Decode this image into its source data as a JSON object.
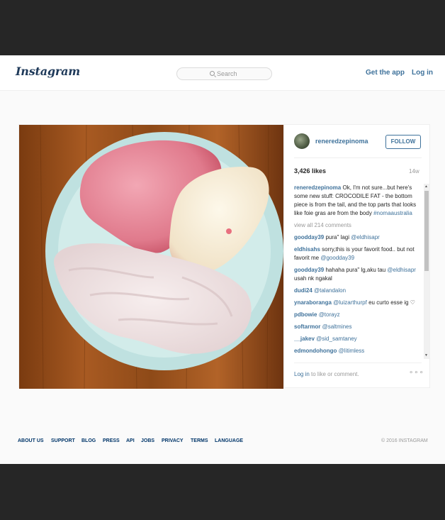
{
  "header": {
    "logo": "Instagram",
    "search_placeholder": "Search",
    "get_app": "Get the app",
    "login": "Log in"
  },
  "post": {
    "owner": "reneredzepinoma",
    "follow_label": "FOLLOW",
    "likes": "3,426 likes",
    "age": "14w",
    "caption": {
      "user": "reneredzepinoma",
      "text": "Ok, I'm not sure...but here's some new stuff: CROCODILE FAT - the bottom piece is from the tail, and the top parts that looks like foie gras are from the body",
      "hashtag": "#nomaaustralia"
    },
    "view_all": "view all 214 comments",
    "comments": [
      {
        "user": "goodday39",
        "text": "pura\" lagi ",
        "mention": "@eldhisapr"
      },
      {
        "user": "eldhisahs",
        "text": "sorry,this is your favorit food.. but not favorit me ",
        "mention": "@goodday39"
      },
      {
        "user": "goodday39",
        "text": "hahaha pura\" lg,aku tau ",
        "mention": "@eldhisapr",
        "tail": " usah nk ngakal"
      },
      {
        "user": "dudi24",
        "text": "",
        "mention": "@talandalon"
      },
      {
        "user": "ynaraboranga",
        "text": "",
        "mention": "@luizarthurpf",
        "tail": " eu curto esse ig ♡"
      },
      {
        "user": "pdbowie",
        "text": "",
        "mention": "@torayz"
      },
      {
        "user": "softarmor",
        "text": "",
        "mention": "@saltmines"
      },
      {
        "user": "__jakev",
        "text": "",
        "mention": "@sid_samtaney"
      },
      {
        "user": "edmondohongo",
        "text": "",
        "mention": "@litimless"
      }
    ],
    "login_prompt": {
      "link": "Log in",
      "rest": " to like or comment."
    },
    "more": "∘∘∘"
  },
  "footer": {
    "links": [
      "ABOUT US",
      "SUPPORT",
      "BLOG",
      "PRESS",
      "API",
      "JOBS",
      "PRIVACY",
      "TERMS",
      "LANGUAGE"
    ],
    "copyright": "© 2016 INSTAGRAM"
  },
  "colors": {
    "link": "#3f729b",
    "footer_link": "#003569",
    "frame": "#262626"
  }
}
